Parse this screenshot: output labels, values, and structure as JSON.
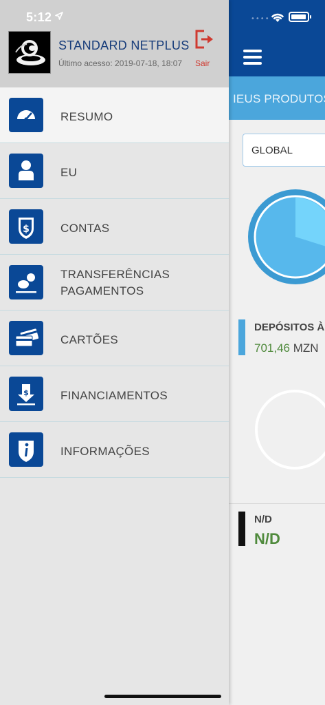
{
  "status_bar": {
    "time": "5:12"
  },
  "user": {
    "name": "STANDARD NETPLUS",
    "last_access": "Último acesso: 2019-07-18, 18:07",
    "logout_label": "Sair"
  },
  "menu": {
    "items": [
      {
        "label": "RESUMO",
        "icon": "speedometer-icon",
        "active": true
      },
      {
        "label": "EU",
        "icon": "person-icon"
      },
      {
        "label": "CONTAS",
        "icon": "dollar-shield-icon"
      },
      {
        "label_line1": "TRANSFERÊNCIAS",
        "label_line2": "PAGAMENTOS",
        "icon": "transfer-coins-icon"
      },
      {
        "label": "CARTÕES",
        "icon": "cards-icon"
      },
      {
        "label": "FINANCIAMENTOS",
        "icon": "financing-download-icon"
      },
      {
        "label": "INFORMAÇÕES",
        "icon": "info-shield-icon"
      }
    ]
  },
  "app": {
    "tab_label": "IEUS PRODUTOS",
    "filter_select": "GLOBAL",
    "deposits": {
      "title": "DEPÓSITOS À",
      "amount": "701,46",
      "currency": "MZN"
    },
    "nd": {
      "title": "N/D",
      "value": "N/D"
    }
  },
  "colors": {
    "brand_blue": "#0a4896",
    "accent_light_blue": "#4ba6dc",
    "logout_red": "#cf3a30",
    "value_green": "#4f8a3c"
  }
}
